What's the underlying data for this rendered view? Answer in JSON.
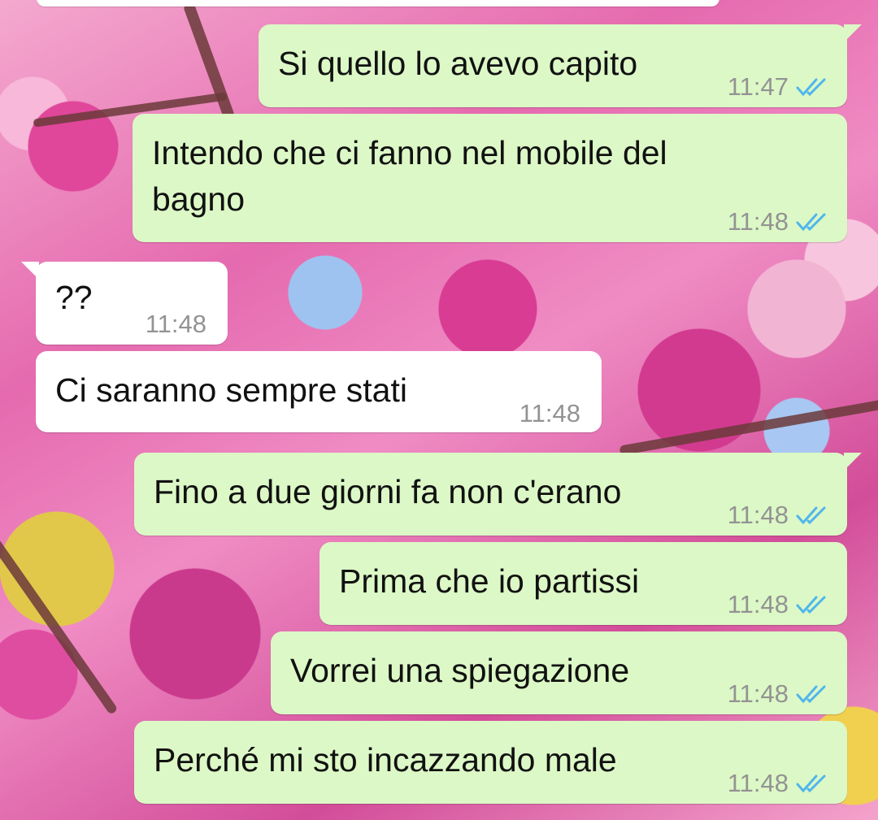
{
  "chat": {
    "messages": [
      {
        "direction": "out",
        "text": "Si quello lo avevo capito",
        "time": "11:47",
        "status_icon": "double-check-read-icon"
      },
      {
        "direction": "out",
        "text": "Intendo che ci fanno nel mobile del",
        "text2": "bagno",
        "time": "11:48",
        "status_icon": "double-check-read-icon"
      },
      {
        "direction": "in",
        "text": "??",
        "time": "11:48"
      },
      {
        "direction": "in",
        "text": "Ci saranno sempre stati",
        "time": "11:48"
      },
      {
        "direction": "out",
        "text": "Fino a due giorni fa non c'erano",
        "time": "11:48",
        "status_icon": "double-check-read-icon"
      },
      {
        "direction": "out",
        "text": "Prima che io partissi",
        "time": "11:48",
        "status_icon": "double-check-read-icon"
      },
      {
        "direction": "out",
        "text": "Vorrei una spiegazione",
        "time": "11:48",
        "status_icon": "double-check-read-icon"
      },
      {
        "direction": "out",
        "text": "Perché mi sto incazzando male",
        "time": "11:48",
        "status_icon": "double-check-read-icon"
      }
    ]
  },
  "colors": {
    "outgoing_bubble": "#dcf8c6",
    "incoming_bubble": "#ffffff",
    "read_ticks": "#4fb6ec",
    "timestamp": "#939393"
  }
}
